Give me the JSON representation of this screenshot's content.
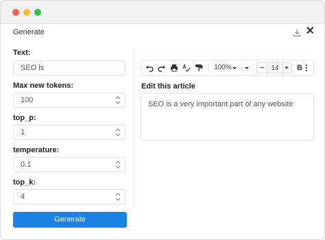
{
  "window": {
    "title": "Generate",
    "download_icon": "download-icon",
    "close_glyph": "✕"
  },
  "form": {
    "text": {
      "label": "Text:",
      "value": "SEO is"
    },
    "max_new_tokens": {
      "label": "Max new tokens:",
      "value": "100"
    },
    "top_p": {
      "label": "top_p:",
      "value": "1"
    },
    "temperature": {
      "label": "temperature:",
      "value": "0.1"
    },
    "top_k": {
      "label": "top_k:",
      "value": "4"
    },
    "generate_label": "Generate"
  },
  "toolbar": {
    "zoom": "100%",
    "font_size": "14",
    "bold": "B",
    "minus": "−",
    "plus": "+"
  },
  "editor": {
    "label": "Edit this article",
    "content": "SEO is a very important part of any website"
  },
  "colors": {
    "accent": "#1a82e2",
    "traffic_red": "#fe5f57",
    "traffic_yellow": "#febc2e",
    "traffic_green": "#28c840"
  }
}
